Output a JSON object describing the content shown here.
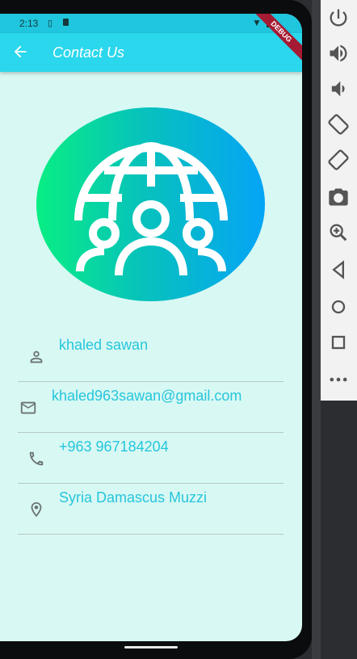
{
  "status_bar": {
    "time": "2:13"
  },
  "app_bar": {
    "title": "Contact Us",
    "debug_label": "DEBUG"
  },
  "contacts": [
    {
      "icon": "person-icon",
      "text": "khaled sawan"
    },
    {
      "icon": "email-icon",
      "text": "khaled963sawan@gmail.com"
    },
    {
      "icon": "phone-icon",
      "text": "+963 967184204"
    },
    {
      "icon": "location-icon",
      "text": "Syria Damascus Muzzi"
    }
  ],
  "colors": {
    "app_bar": "#2ad7ec",
    "status_bar": "#1fc6dd",
    "background": "#d8f8f3",
    "text_accent": "#26c6dc",
    "logo_gradient": [
      "#08ee83",
      "#05a4f6"
    ]
  },
  "emulator_toolbar": {
    "icons": [
      "power-icon",
      "volume-up-icon",
      "volume-down-icon",
      "rotate-left-icon",
      "rotate-right-icon",
      "camera-icon",
      "zoom-icon",
      "back-nav-icon",
      "home-nav-icon",
      "overview-nav-icon",
      "more-icon"
    ]
  }
}
